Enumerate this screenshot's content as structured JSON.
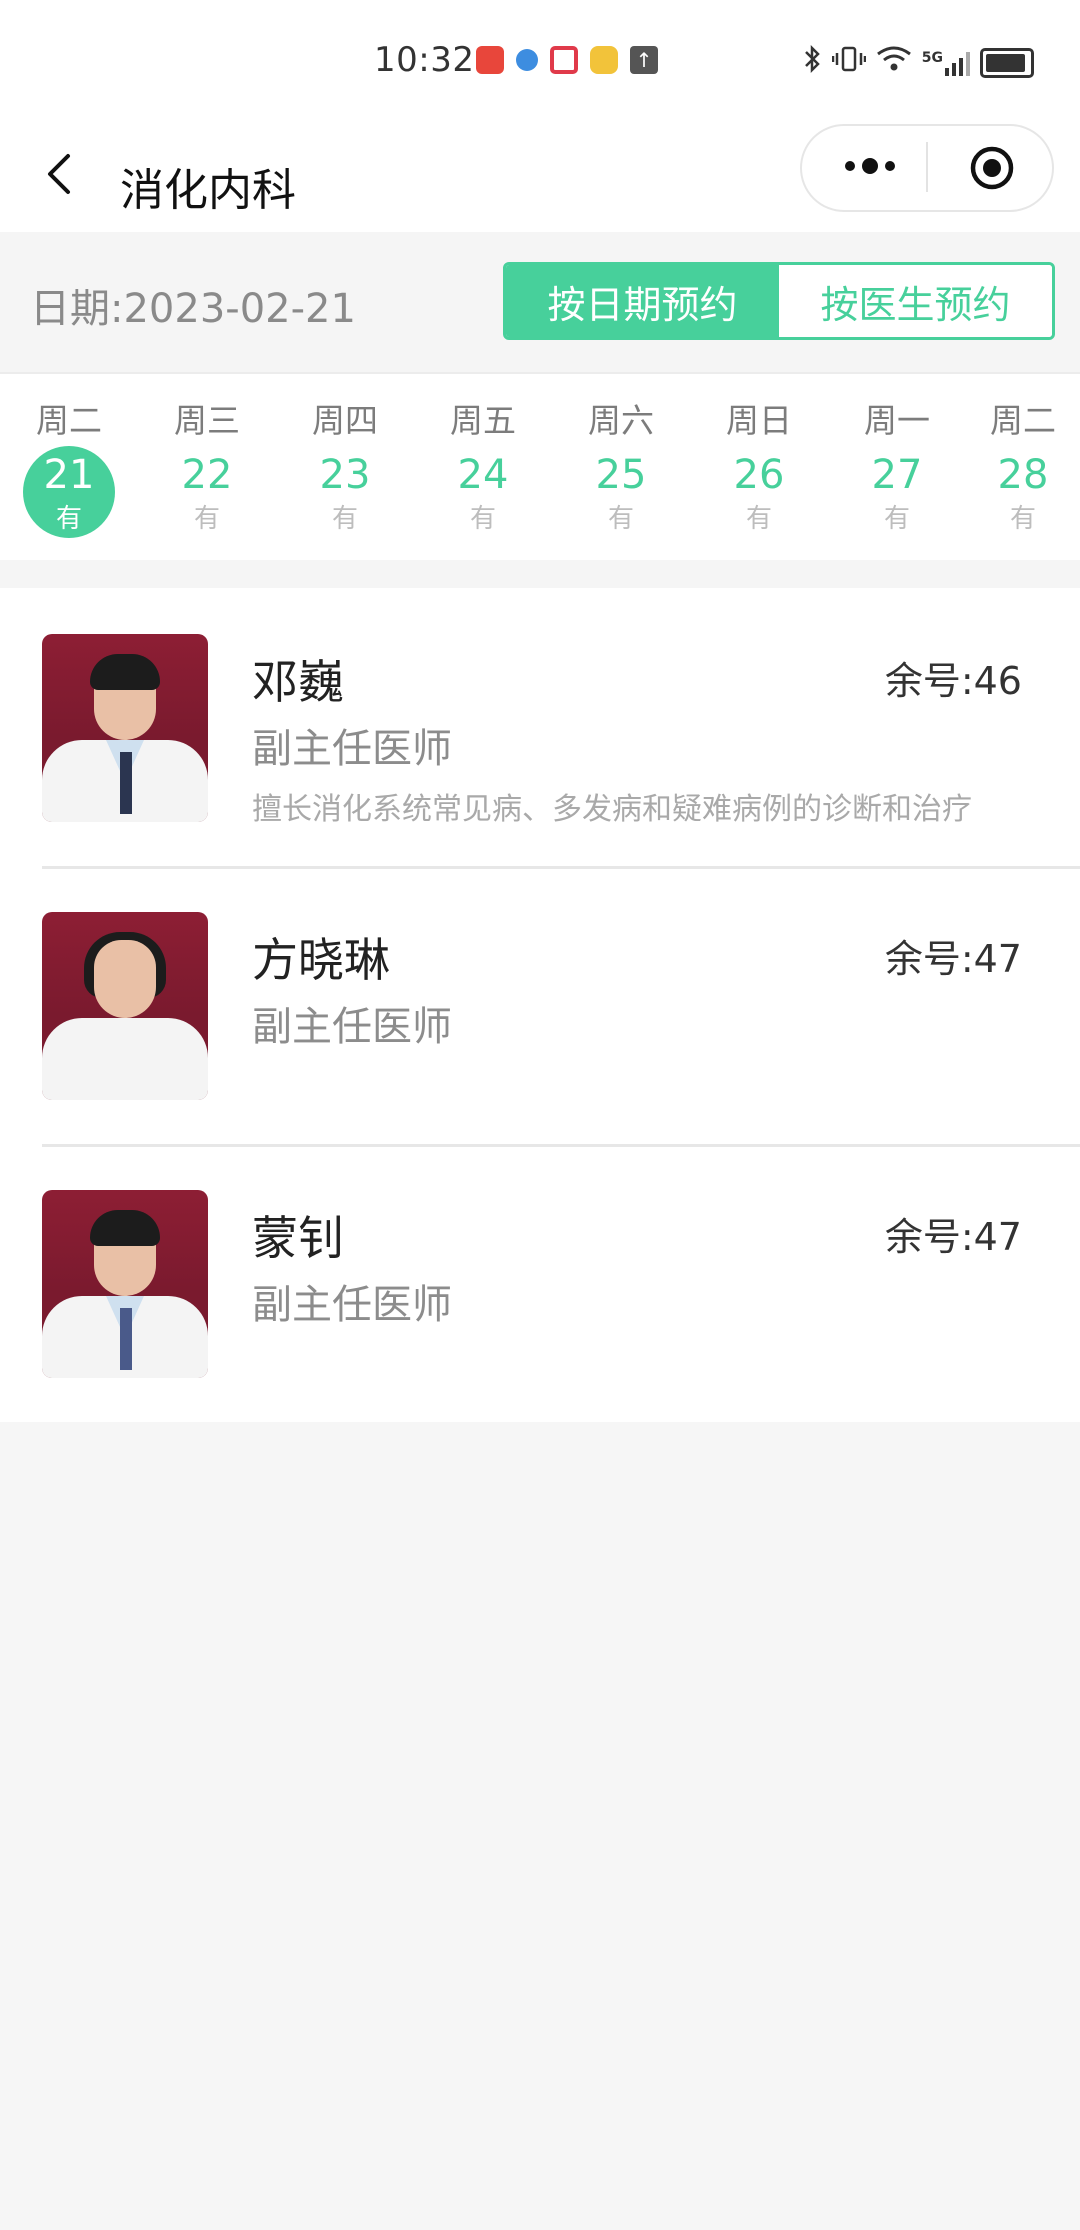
{
  "status_bar": {
    "time": "10:32",
    "notification_icons": [
      "news-app-icon",
      "browser-icon",
      "red-book-icon",
      "weibo-icon",
      "upload-icon"
    ],
    "system_icons": [
      "bluetooth-icon",
      "vibrate-icon",
      "wifi-icon",
      "5g-signal-icon",
      "battery-icon"
    ],
    "network_label": "5G"
  },
  "nav": {
    "title": "消化内科",
    "back_icon": "chevron-left-icon",
    "more_icon": "more-dots-icon",
    "close_icon": "target-circle-icon"
  },
  "date_header": {
    "label": "日期:2023-02-21",
    "mode_by_date": "按日期预约",
    "mode_by_doctor": "按医生预约",
    "active_mode": "by_date"
  },
  "week": [
    {
      "weekday": "周二",
      "day": "21",
      "avail": "有",
      "selected": true
    },
    {
      "weekday": "周三",
      "day": "22",
      "avail": "有",
      "selected": false
    },
    {
      "weekday": "周四",
      "day": "23",
      "avail": "有",
      "selected": false
    },
    {
      "weekday": "周五",
      "day": "24",
      "avail": "有",
      "selected": false
    },
    {
      "weekday": "周六",
      "day": "25",
      "avail": "有",
      "selected": false
    },
    {
      "weekday": "周日",
      "day": "26",
      "avail": "有",
      "selected": false
    },
    {
      "weekday": "周一",
      "day": "27",
      "avail": "有",
      "selected": false
    },
    {
      "weekday": "周二",
      "day": "28",
      "avail": "有",
      "selected": false
    }
  ],
  "doctors": [
    {
      "name": "邓巍",
      "title": "副主任医师",
      "remaining": "余号:46",
      "description": "擅长消化系统常见病、多发病和疑难病例的诊断和治疗",
      "photo": "doctor-photo-male"
    },
    {
      "name": "方晓琳",
      "title": "副主任医师",
      "remaining": "余号:47",
      "description": "",
      "photo": "doctor-photo-female"
    },
    {
      "name": "蒙钊",
      "title": "副主任医师",
      "remaining": "余号:47",
      "description": "",
      "photo": "doctor-photo-male"
    }
  ],
  "colors": {
    "accent": "#47d09b",
    "photo_bg": "#7a1a2e",
    "page_bg": "#f6f6f6"
  }
}
